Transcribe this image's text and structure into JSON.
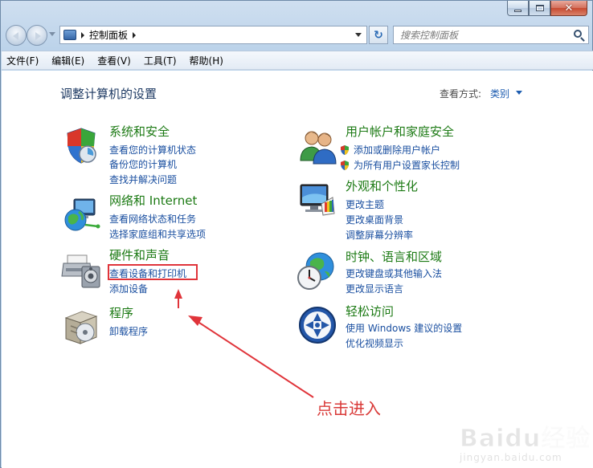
{
  "window": {
    "caption_buttons": [
      "minimize-icon",
      "maximize-icon",
      "close-icon"
    ],
    "close_glyph": "✕"
  },
  "address_bar": {
    "breadcrumb": "控制面板",
    "refresh_glyph": "↻"
  },
  "search": {
    "placeholder": "搜索控制面板"
  },
  "menu": [
    "文件(F)",
    "编辑(E)",
    "查看(V)",
    "工具(T)",
    "帮助(H)"
  ],
  "page": {
    "title": "调整计算机的设置",
    "view_label": "查看方式:",
    "view_value": "类别"
  },
  "categories": [
    {
      "title": "系统和安全",
      "links": [
        "查看您的计算机状态",
        "备份您的计算机",
        "查找并解决问题"
      ],
      "icon": "shield-icon"
    },
    {
      "title": "网络和 Internet",
      "links": [
        "查看网络状态和任务",
        "选择家庭组和共享选项"
      ],
      "icon": "network-globe-icon"
    },
    {
      "title": "硬件和声音",
      "links": [
        "查看设备和打印机",
        "添加设备"
      ],
      "icon": "printer-icon"
    },
    {
      "title": "程序",
      "links": [
        "卸载程序"
      ],
      "icon": "programs-box-icon"
    },
    {
      "title": "用户帐户和家庭安全",
      "links": [
        "添加或删除用户帐户",
        "为所有用户设置家长控制"
      ],
      "icon": "users-icon"
    },
    {
      "title": "外观和个性化",
      "links": [
        "更改主题",
        "更改桌面背景",
        "调整屏幕分辨率"
      ],
      "icon": "monitor-paint-icon"
    },
    {
      "title": "时钟、语言和区域",
      "links": [
        "更改键盘或其他输入法",
        "更改显示语言"
      ],
      "icon": "clock-globe-icon"
    },
    {
      "title": "轻松访问",
      "links": [
        "使用 Windows 建议的设置",
        "优化视频显示"
      ],
      "icon": "ease-of-access-icon"
    }
  ],
  "annotation": {
    "text": "点击进入",
    "color": "#d93a38"
  },
  "watermark": {
    "brand": "Baidu经验",
    "url": "jingyan.baidu.com"
  },
  "colors": {
    "link": "#1a4fa0",
    "category_title": "#1c7a14",
    "title": "#1e3a63",
    "highlight": "#e0343a"
  }
}
